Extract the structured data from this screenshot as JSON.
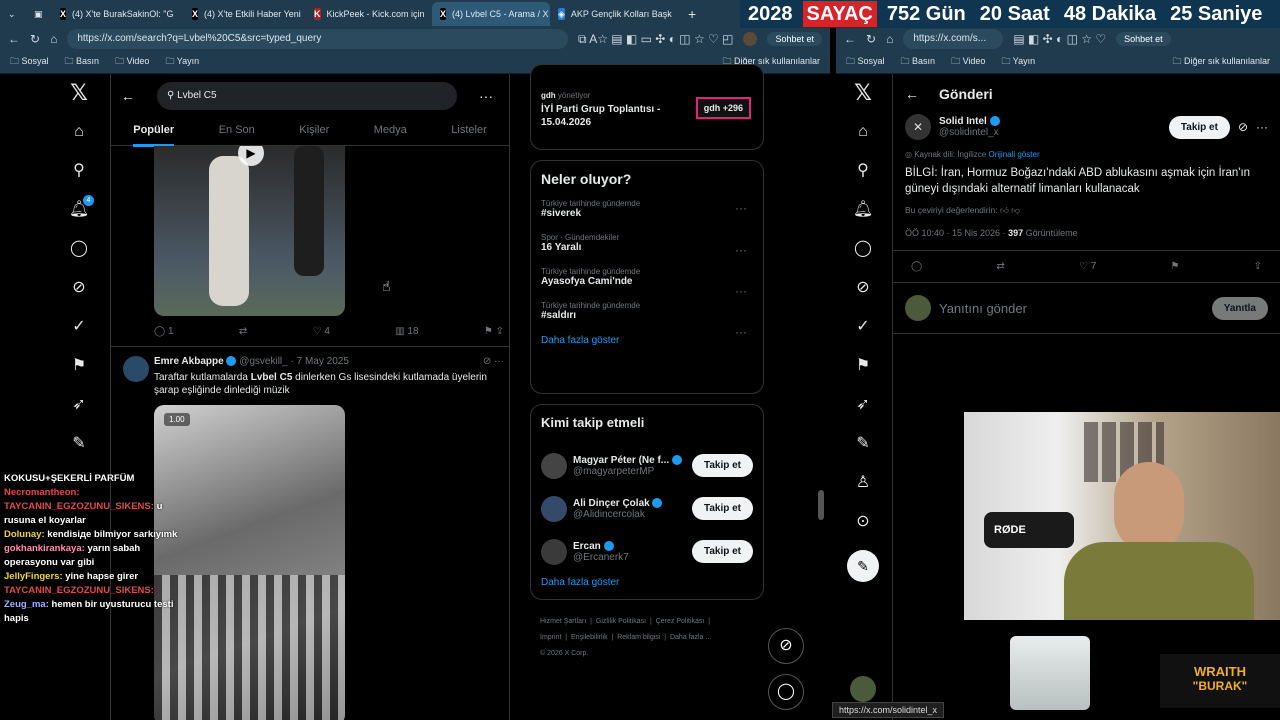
{
  "tabs": [
    {
      "label": "(4) X'te BurakSakinOl: \"G",
      "active": false
    },
    {
      "label": "(4) X'te Etkili Haber Yeni",
      "active": false
    },
    {
      "label": "KickPeek - Kick.com için",
      "active": false
    },
    {
      "label": "(4) Lvbel C5 - Arama / X",
      "active": true
    },
    {
      "label": "AKP Gençlik Kolları Başk",
      "active": false
    }
  ],
  "counter": {
    "year": "2028",
    "label": "SAYAÇ",
    "days": "752 Gün",
    "hours": "20 Saat",
    "minutes": "48 Dakika",
    "seconds": "25 Saniye"
  },
  "left_browser": {
    "url": "https://x.com/search?q=Lvbel%20C5&src=typed_query",
    "chat_button": "Sohbet et",
    "bookmarks": [
      "Sosyal",
      "Basın",
      "Video",
      "Yayın"
    ],
    "other_bookmarks": "Diğer sık kullanılanlar"
  },
  "right_browser": {
    "url": "https://x.com/s...",
    "chat_button": "Sohbet et",
    "bookmarks": [
      "Sosyal",
      "Basın",
      "Video",
      "Yayın"
    ],
    "other_bookmarks": "Diğer sık kullanılanlar"
  },
  "search": {
    "query": "Lvbel C5",
    "tabs": [
      "Popüler",
      "En Son",
      "Kişiler",
      "Medya",
      "Listeler"
    ]
  },
  "tweet1": {
    "replies": "1",
    "likes": "4",
    "views": "18"
  },
  "tweet2": {
    "name": "Emre Akbappe",
    "handle": "@gsvekill_",
    "date": "· 7 May 2025",
    "text_pre": "Taraftar kutlamalarda ",
    "text_bold": "Lvbel C5",
    "text_post": " dinlerken Gs lisesindeki kutlamada üyelerin şarap eşliğinde dinlediği müzik",
    "video_speed": "1.00"
  },
  "sponsored": {
    "org": "gdh",
    "role": "yönetiyor",
    "title": "İYİ Parti Grup Toplantısı - 15.04.2026",
    "badge": "gdh +296"
  },
  "trends": {
    "title": "Neler oluyor?",
    "items": [
      {
        "context": "Türkiye tarihinde gündemde",
        "name": "#siverek"
      },
      {
        "context": "Spor · Gündemdekiler",
        "name": "16 Yaralı"
      },
      {
        "context": "Türkiye tarihinde gündemde",
        "name": "Ayasofya Cami'nde"
      },
      {
        "context": "Türkiye tarihinde gündemde",
        "name": "#saldırı"
      }
    ],
    "more": "Daha fazla göster"
  },
  "who_to_follow": {
    "title": "Kimi takip etmeli",
    "users": [
      {
        "name": "Magyar Péter (Ne f...",
        "handle": "@magyarpeterMP",
        "button": "Takip et"
      },
      {
        "name": "Ali Dinçer Çolak",
        "handle": "@Alidincercolak",
        "button": "Takip et"
      },
      {
        "name": "Ercan",
        "handle": "@Ercanerk7",
        "button": "Takip et"
      }
    ],
    "more": "Daha fazla göster"
  },
  "footer": {
    "links": [
      "Hizmet Şartları",
      "Gizlilik Politikası",
      "Çerez Politikası",
      "Imprint",
      "Erişilebilirlik",
      "Reklam bilgisi",
      "Daha fazla ..."
    ],
    "copyright": "© 2026 X Corp."
  },
  "chat": [
    {
      "user": "KOKUSU+ŞEKERLİ PARFÜM",
      "text": "",
      "color": "#ffffff"
    },
    {
      "user": "Necromantheon:",
      "text": "",
      "color": "#e04b4b"
    },
    {
      "user": "TAYCANIN_EGZOZUNU_SIKENS:",
      "text": "u rusuna el koyarlar",
      "color": "#e04b4b"
    },
    {
      "user": "Dolunay:",
      "text": "kendisiде bilmiyor sarkıyımk",
      "color": "#f2d43a"
    },
    {
      "user": "gokhankirankaya:",
      "text": "yarın sabah operasyonu var gibi",
      "color": "#ff8fb0"
    },
    {
      "user": "JellyFingers:",
      "text": "yine hapse girer",
      "color": "#f2d43a"
    },
    {
      "user": "TAYCANIN_EGZOZUNU_SIKENS:",
      "text": "",
      "color": "#e04b4b"
    },
    {
      "user": "Zeug_ma:",
      "text": "hemen bir uyusturucu testi hapis",
      "color": "#9ab3ff"
    }
  ],
  "post": {
    "header": "Gönderi",
    "name": "Solid Intel",
    "handle": "@solidintel_x",
    "follow": "Takip et",
    "source_lang": "Kaynak dili: İngilizce",
    "show_original": "Orijinali göster",
    "text": "BİLGİ: İran, Hormuz Boğazı'ndaki ABD ablukasını aşmak için İran'ın güneyi dışındaki alternatif limanları kullanacak",
    "rate": "Bu çeviriyi değerlendirin:",
    "time": "ÖÖ 10:40 · 15 Nis 2026 · ",
    "views": "397",
    "views_label": " Görüntüleme",
    "likes": "7",
    "reply_placeholder": "Yanıtını gönder",
    "reply_button": "Yanıtla"
  },
  "status_url": "https://x.com/solidintel_x",
  "overlay": {
    "line1": "WRAITH",
    "line2": "\"BURAK\""
  },
  "notification_count": "4",
  "colors": {
    "accent": "#1d9bf0",
    "tabbar": "#1f3b4d",
    "counter_red": "#d8232a",
    "badge_pink": "#e0247a"
  }
}
